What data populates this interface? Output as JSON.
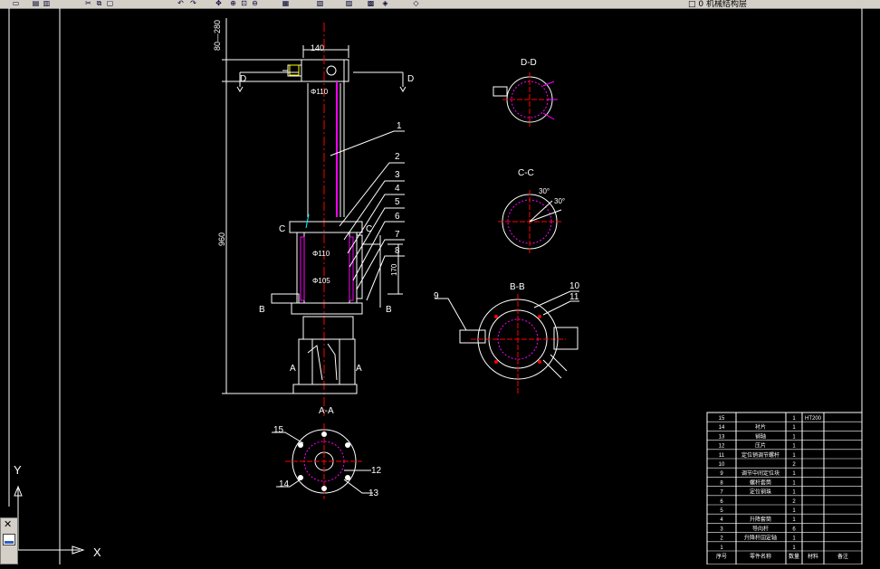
{
  "toolbar": {
    "icons": [
      "open-icon",
      "save-icon",
      "print-icon",
      "cut-icon",
      "copy-icon",
      "paste-icon",
      "undo-icon",
      "redo-icon",
      "pan-icon",
      "zoom-realtime-icon",
      "zoom-window-icon",
      "zoom-previous-icon",
      "properties-icon",
      "design-center-icon",
      "tool-palette-icon",
      "calculator-icon",
      "layers-icon",
      "layer-state-icon"
    ],
    "layer_text": "□  0 机械结构层"
  },
  "drawing": {
    "dim_top": "80—280",
    "dim_width": "140",
    "dim_height": "960",
    "dim_side": "170",
    "dia_top": "Φ110",
    "dia_mid": "Φ110",
    "dia_low": "Φ105",
    "cut_D": "D",
    "cut_C": "C",
    "cut_B": "B",
    "cut_A": "A",
    "view_dd": "D-D",
    "view_cc": "C-C",
    "view_bb": "B-B",
    "view_aa": "A-A",
    "angle_a": "30°",
    "angle_b": "30°",
    "balloons": [
      "1",
      "2",
      "3",
      "4",
      "5",
      "6",
      "7",
      "8",
      "9",
      "10",
      "11",
      "12",
      "13",
      "14",
      "15"
    ]
  },
  "ucs": {
    "y_label": "Y",
    "x_label": "X"
  },
  "bom": {
    "header": {
      "no": "序号",
      "name": "零件名称",
      "qty": "数量",
      "mat": "材料",
      "note": "备注"
    },
    "rows": [
      {
        "no": "15",
        "name": "",
        "qty": "1",
        "mat": "HT200"
      },
      {
        "no": "14",
        "name": "衬片",
        "qty": "1",
        "mat": ""
      },
      {
        "no": "13",
        "name": "销轴",
        "qty": "1",
        "mat": ""
      },
      {
        "no": "12",
        "name": "压片",
        "qty": "1",
        "mat": ""
      },
      {
        "no": "11",
        "name": "定位销调节螺杆",
        "qty": "1",
        "mat": ""
      },
      {
        "no": "10",
        "name": "",
        "qty": "2",
        "mat": ""
      },
      {
        "no": "9",
        "name": "调节中间定位块",
        "qty": "1",
        "mat": ""
      },
      {
        "no": "8",
        "name": "螺杆套筒",
        "qty": "1",
        "mat": ""
      },
      {
        "no": "7",
        "name": "定位钢珠",
        "qty": "1",
        "mat": ""
      },
      {
        "no": "6",
        "name": "",
        "qty": "2",
        "mat": ""
      },
      {
        "no": "5",
        "name": "",
        "qty": "1",
        "mat": ""
      },
      {
        "no": "4",
        "name": "升降套筒",
        "qty": "1",
        "mat": ""
      },
      {
        "no": "3",
        "name": "导向杆",
        "qty": "6",
        "mat": ""
      },
      {
        "no": "2",
        "name": "升降杆固定轴",
        "qty": "1",
        "mat": ""
      },
      {
        "no": "1",
        "name": "",
        "qty": "1",
        "mat": ""
      }
    ]
  },
  "colors": {
    "background": "#000000",
    "line": "#ffffff",
    "center_line": "#ff0000",
    "hatch": "#ff00ff",
    "hidden": "#00ffff",
    "ui_gray": "#d4d0c8"
  }
}
